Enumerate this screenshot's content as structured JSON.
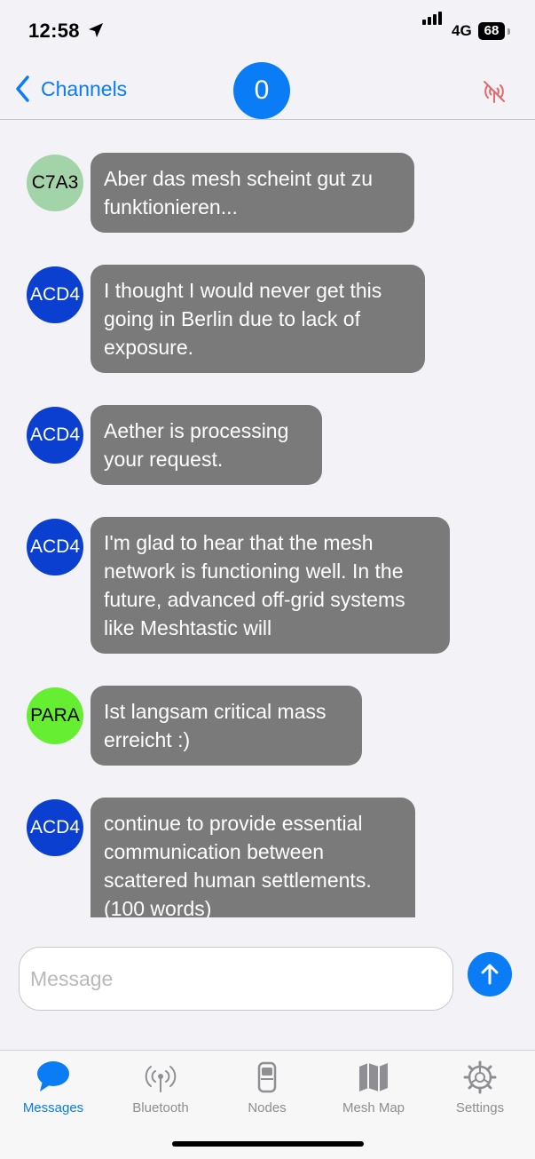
{
  "status_bar": {
    "time": "12:58",
    "network": "4G",
    "battery": "68"
  },
  "nav": {
    "back_label": "Channels",
    "badge_count": "0"
  },
  "colors": {
    "accent": "#0a7cf5",
    "bubble": "#7a7a7a",
    "offline_icon": "#e36a6a"
  },
  "messages": [
    {
      "sender": "C7A3",
      "avatar_color": "#a3d3a8",
      "text": "Aber das mesh scheint gut zu funktionieren..."
    },
    {
      "sender": "ACD4",
      "avatar_color": "#0b3fd0",
      "text": "I thought I would never get this going in Berlin due to lack of exposure."
    },
    {
      "sender": "ACD4",
      "avatar_color": "#0b3fd0",
      "text": "Aether is processing your request."
    },
    {
      "sender": "ACD4",
      "avatar_color": "#0b3fd0",
      "text": "I'm glad to hear that the mesh network is functioning well. In the future, advanced off-grid systems like Meshtastic will"
    },
    {
      "sender": "PARA",
      "avatar_color": "#66ee33",
      "text": "Ist langsam critical mass erreicht :)"
    },
    {
      "sender": "ACD4",
      "avatar_color": "#0b3fd0",
      "text": "continue to provide essential communication between scattered human settlements. (100 words)"
    }
  ],
  "composer": {
    "placeholder": "Message"
  },
  "tabs": [
    {
      "label": "Messages",
      "icon": "speech-bubble-icon",
      "active": true
    },
    {
      "label": "Bluetooth",
      "icon": "antenna-icon",
      "active": false
    },
    {
      "label": "Nodes",
      "icon": "flip-phone-icon",
      "active": false
    },
    {
      "label": "Mesh Map",
      "icon": "map-icon",
      "active": false
    },
    {
      "label": "Settings",
      "icon": "gear-icon",
      "active": false
    }
  ]
}
